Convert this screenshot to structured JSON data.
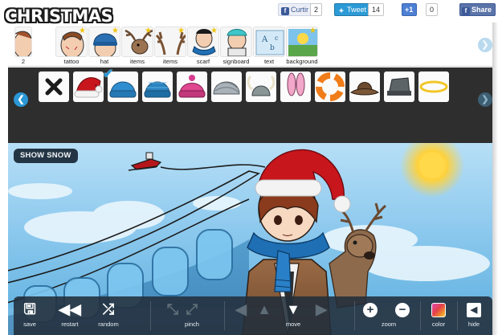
{
  "app": {
    "logo_text": "CHRISTMAS"
  },
  "social": {
    "fb_like_label": "Curtir",
    "fb_like_count": "2",
    "tweet_label": "Tweet",
    "tweet_count": "14",
    "gplus_label": "+1",
    "gplus_count": "0",
    "fb_share_label": "Share"
  },
  "categories": [
    {
      "label": "2",
      "icon": "partial-face-icon"
    },
    {
      "label": "tattoo",
      "icon": "tattoo-face-icon",
      "star": true
    },
    {
      "label": "hat",
      "icon": "hat-face-icon",
      "star": true
    },
    {
      "label": "items",
      "icon": "reindeer-icon",
      "star": true
    },
    {
      "label": "items",
      "icon": "antlers-icon",
      "star": true
    },
    {
      "label": "scarf",
      "icon": "scarf-icon",
      "star": true
    },
    {
      "label": "signboard",
      "icon": "signboard-icon"
    },
    {
      "label": "text",
      "icon": "text-icon"
    },
    {
      "label": "background",
      "icon": "background-icon",
      "star": true
    }
  ],
  "items": [
    {
      "icon": "none-x-icon"
    },
    {
      "icon": "santa-hat-icon",
      "selected": true
    },
    {
      "icon": "blue-beanie-icon"
    },
    {
      "icon": "teal-beanie-icon"
    },
    {
      "icon": "pink-beanie-icon"
    },
    {
      "icon": "turban-icon"
    },
    {
      "icon": "viking-helmet-icon"
    },
    {
      "icon": "bunny-ears-icon"
    },
    {
      "icon": "life-ring-icon"
    },
    {
      "icon": "cowboy-hat-icon"
    },
    {
      "icon": "grey-hat-icon"
    },
    {
      "icon": "halo-icon"
    }
  ],
  "scene": {
    "show_snow_label": "SHOW SNOW"
  },
  "toolbar": {
    "save": "save",
    "restart": "restart",
    "random": "random",
    "pinch": "pinch",
    "move": "move",
    "zoom": "zoom",
    "color": "color",
    "hide": "hide"
  },
  "colors": {
    "accent": "#2b97d6",
    "panel": "#2e2e2e",
    "toolbar": "#222e3a",
    "santa_red": "#c8161d"
  }
}
